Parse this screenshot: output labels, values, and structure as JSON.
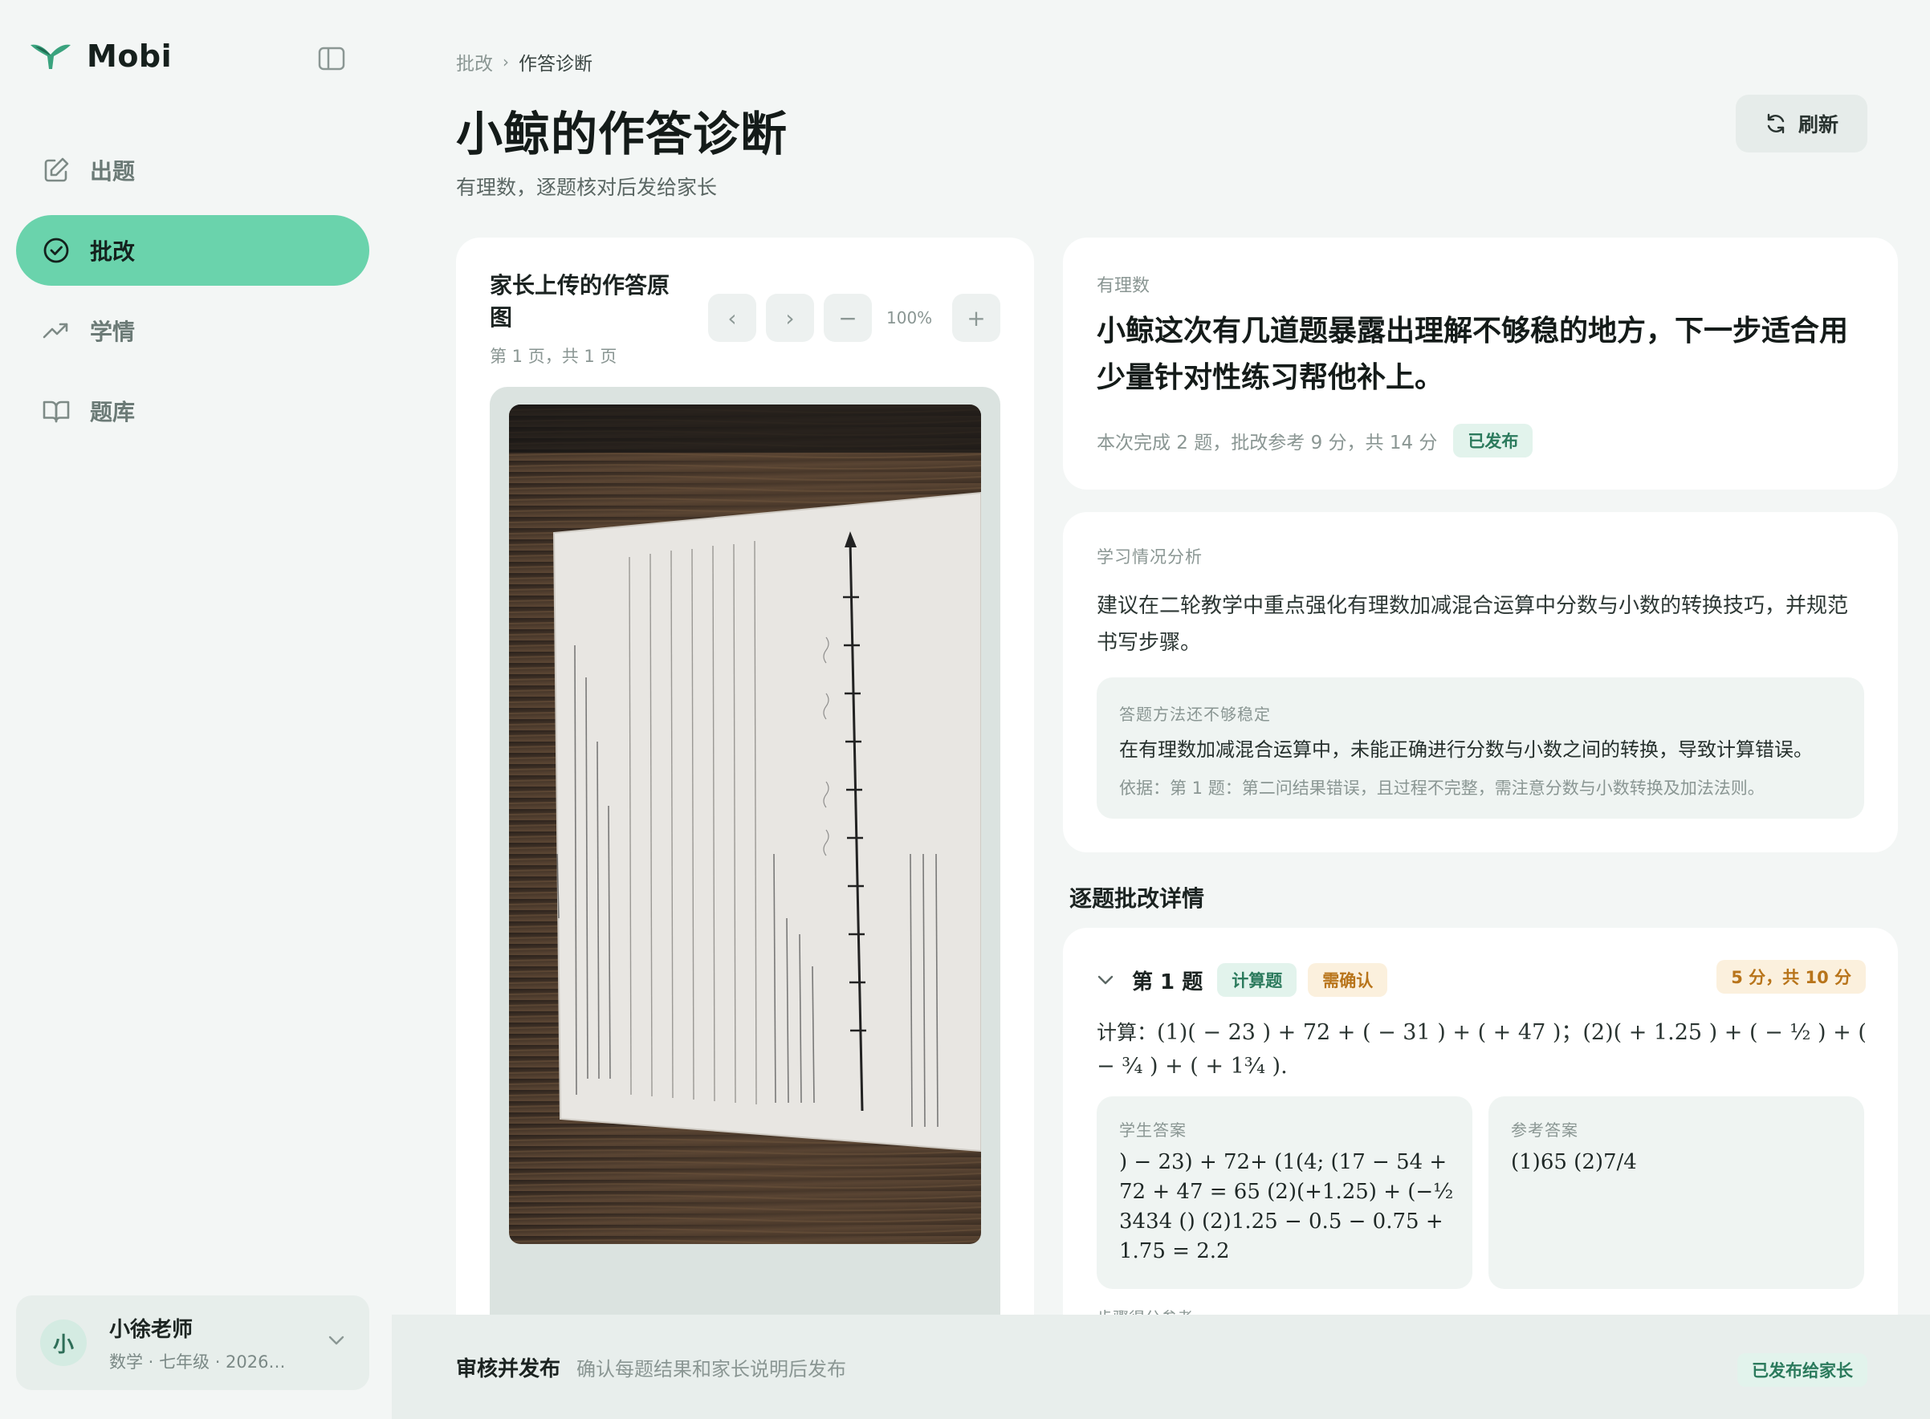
{
  "app": {
    "name": "Mobi"
  },
  "sidebar": {
    "items": [
      {
        "label": "出题",
        "icon": "edit-icon"
      },
      {
        "label": "批改",
        "icon": "check-circle-icon",
        "active": true
      },
      {
        "label": "学情",
        "icon": "trend-icon"
      },
      {
        "label": "题库",
        "icon": "book-icon"
      }
    ],
    "user": {
      "avatar": "小",
      "name": "小徐老师",
      "meta": "数学 · 七年级 · 2026…"
    }
  },
  "header": {
    "breadcrumb": [
      "批改",
      "作答诊断"
    ],
    "breadcrumb_sep": "›",
    "title": "小鲸的作答诊断",
    "subtitle": "有理数，逐题核对后发给家长",
    "refresh_label": "刷新"
  },
  "viewer": {
    "title": "家长上传的作答原图",
    "page_info": "第 1 页，共 1 页",
    "prev": "‹",
    "next": "›",
    "zoom_out": "−",
    "zoom_in": "+",
    "zoom": "100%"
  },
  "summary": {
    "topic": "有理数",
    "headline": "小鲸这次有几道题暴露出理解不够稳的地方，下一步适合用少量针对性练习帮他补上。",
    "meta": "本次完成 2 题，批改参考 9 分，共 14 分",
    "status": "已发布"
  },
  "analysis": {
    "label": "学习情况分析",
    "text": "建议在二轮教学中重点强化有理数加减混合运算中分数与小数的转换技巧，并规范书写步骤。",
    "issue": {
      "label": "答题方法还不够稳定",
      "text": "在有理数加减混合运算中，未能正确进行分数与小数之间的转换，导致计算错误。",
      "basis": "依据：第 1 题：第二问结果错误，且过程不完整，需注意分数与小数转换及加法法则。"
    }
  },
  "details": {
    "title": "逐题批改详情",
    "question": {
      "title": "第 1 题",
      "type": "计算题",
      "flag": "需确认",
      "score": "5 分，共 10 分",
      "problem_label": "计算：",
      "problem": "(1)( − 23 ) + 72 + ( − 31 ) + ( + 47 )；(2)( + 1.25 ) + ( − ½ ) + ( − ¾ ) + ( + 1¾ ).",
      "student_label": "学生答案",
      "student_answer": ") − 23) + 72+ (1(4; (17 − 54 + 72 + 47 = 65 (2)(+1.25) + (−½ 3434 () (2)1.25 − 0.5 − 0.75 + 1.75 = 2.2",
      "reference_label": "参考答案",
      "reference_answer": "(1)65 (2)7/4",
      "step_label": "步骤得分参考"
    }
  },
  "footer": {
    "title": "审核并发布",
    "desc": "确认每题结果和家长说明后发布",
    "status": "已发布给家长"
  },
  "colors": {
    "accent": "#6ad3ac",
    "tag_green": "#2b7a5c",
    "tag_amber": "#b8741a"
  }
}
